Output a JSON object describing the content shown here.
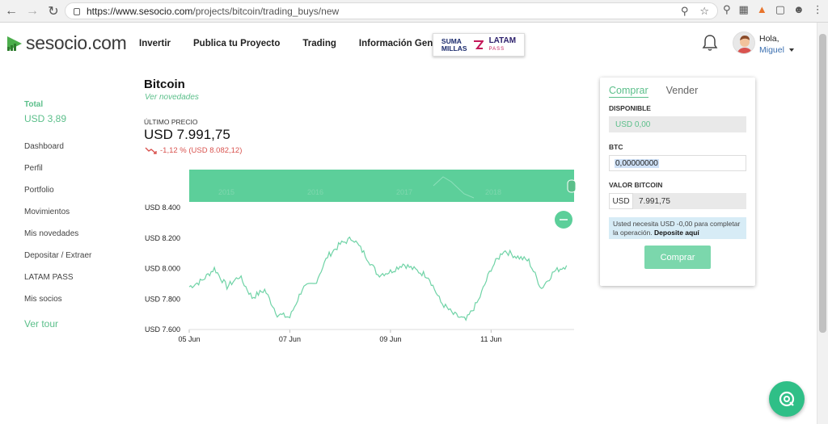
{
  "browser": {
    "url_base": "https://www.sesocio.com",
    "url_path": "/projects/bitcoin/trading_buys/new"
  },
  "header": {
    "logo_text": "sesocio.com",
    "menu": [
      "Invertir",
      "Publica tu Proyecto",
      "Trading",
      "Información General"
    ],
    "promo": {
      "suma_line1": "SUMA",
      "suma_line2": "MILLAS",
      "latam": "LATAM",
      "pass": "PASS"
    },
    "greeting": "Hola,",
    "user_name": "Miguel"
  },
  "sidebar": {
    "total_label": "Total",
    "total_value": "USD 3,89",
    "links": [
      "Dashboard",
      "Perfil",
      "Portfolio",
      "Movimientos",
      "Mis novedades",
      "Depositar / Extraer",
      "LATAM PASS",
      "Mis socios"
    ],
    "tour": "Ver tour"
  },
  "main": {
    "title": "Bitcoin",
    "subtitle": "Ver novedades",
    "last_price_label": "ÚLTIMO PRECIO",
    "last_price": "USD 7.991,75",
    "change": "-1,12 % (USD 8.082,12)"
  },
  "chart_data": {
    "type": "line",
    "navigator_years": [
      "2015",
      "2016",
      "2017",
      "2018"
    ],
    "x_ticks": [
      "05 Jun",
      "07 Jun",
      "09 Jun",
      "11 Jun"
    ],
    "y_ticks": [
      "USD 8.400",
      "USD 8.200",
      "USD 8.000",
      "USD 7.800",
      "USD 7.600"
    ],
    "ylim": [
      7600,
      8400
    ],
    "x": [
      0,
      0.25,
      0.5,
      0.75,
      1,
      1.25,
      1.5,
      1.75,
      2,
      2.25,
      2.5,
      2.75,
      3,
      3.25,
      3.5,
      3.75,
      4,
      4.25,
      4.5,
      4.75,
      5,
      5.25,
      5.5,
      5.75,
      6,
      6.25,
      6.5,
      6.75,
      7,
      7.25,
      7.5
    ],
    "y": [
      7880,
      7920,
      8000,
      7880,
      7950,
      7810,
      7860,
      7700,
      7680,
      7870,
      7900,
      8080,
      8160,
      8200,
      8090,
      7960,
      7980,
      8030,
      7990,
      7950,
      7780,
      7700,
      7660,
      7790,
      8000,
      8120,
      8080,
      8050,
      7870,
      7980,
      8020
    ],
    "series_color": "#6fd3a6",
    "navigator_color": "#5ccf9a"
  },
  "trade": {
    "tab_buy": "Comprar",
    "tab_sell": "Vender",
    "available_label": "DISPONIBLE",
    "available_value": "USD 0,00",
    "btc_label": "BTC",
    "btc_value": "0,00000000",
    "value_label": "VALOR BITCOIN",
    "currency": "USD",
    "value": "7.991,75",
    "notice_text": "Usted necesita USD -0,00 para completar la operación.",
    "notice_link": "Deposite aquí",
    "buy_button": "Comprar"
  }
}
